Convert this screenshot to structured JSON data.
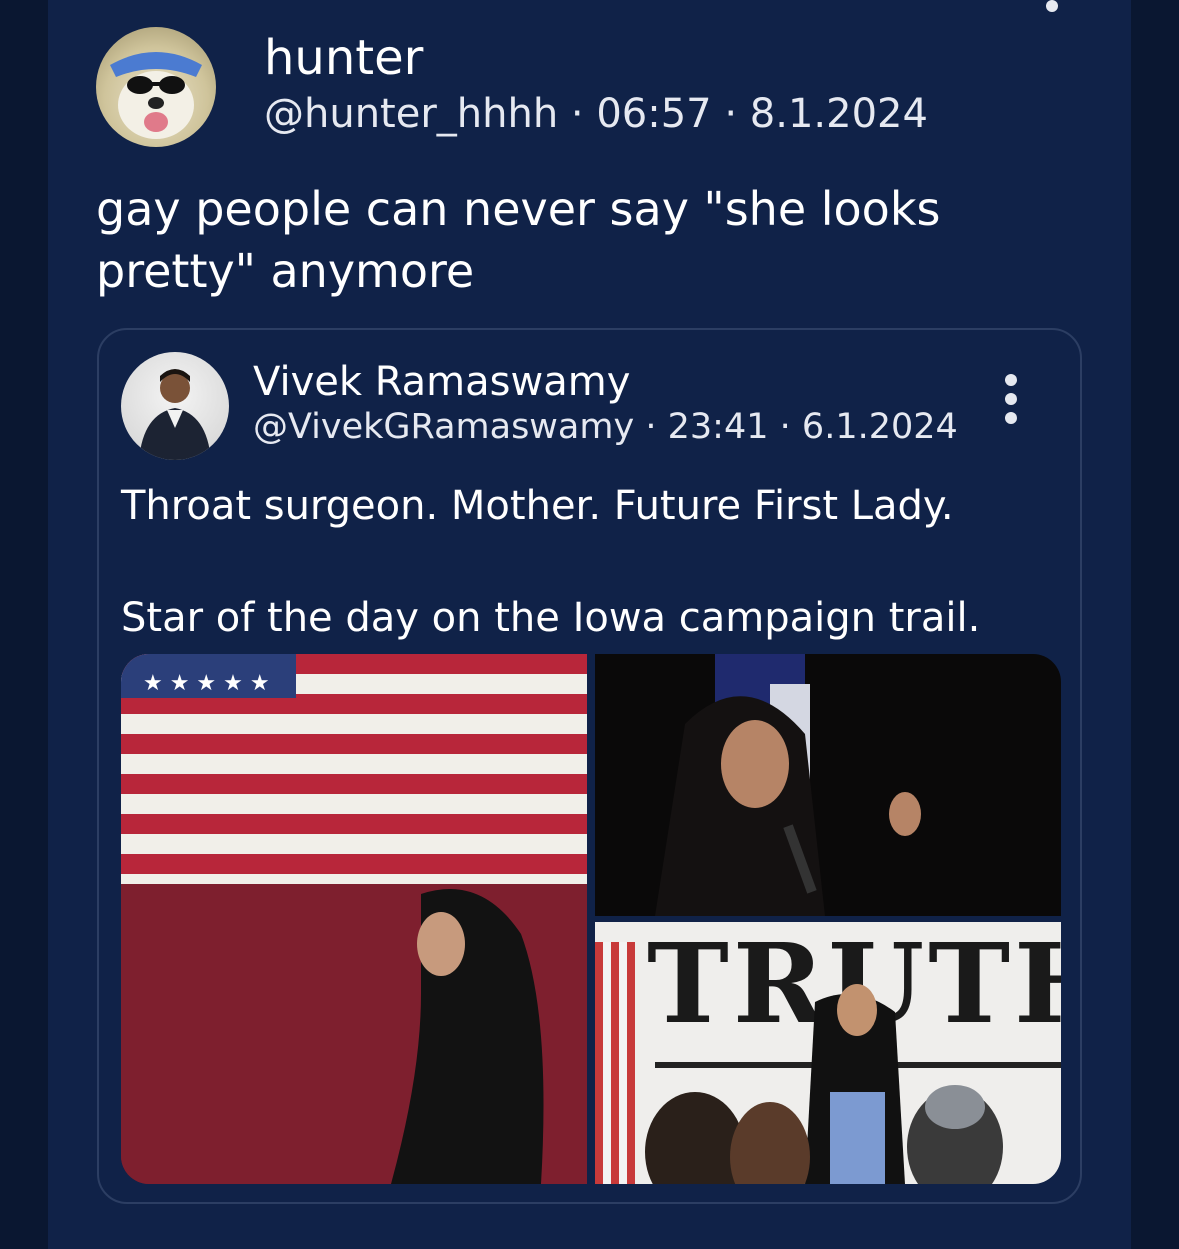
{
  "tweet": {
    "author_name": "hunter",
    "author_handle": "@hunter_hhhh",
    "time": "06:57",
    "date": "8.1.2024",
    "separator": "·",
    "text": "gay people can never say \"she looks pretty\" anymore",
    "avatar_icon": "dog-with-sunglasses-avatar"
  },
  "quote": {
    "author_name": "Vivek Ramaswamy",
    "author_handle": "@VivekGRamaswamy",
    "time": "23:41",
    "date": "6.1.2024",
    "separator": "·",
    "text_line1": "Throat surgeon. Mother. Future First Lady.",
    "text_line2": "Star of the day on the Iowa campaign trail.",
    "more_icon": "more-vertical-icon",
    "media": {
      "photo_count": 3,
      "sign_text": "TRUTH"
    }
  },
  "colors": {
    "background": "#102248",
    "side_gutter": "#0a1731",
    "card_border": "#2c3e63",
    "text_primary": "#ffffff",
    "text_secondary": "#e6e9f1"
  }
}
